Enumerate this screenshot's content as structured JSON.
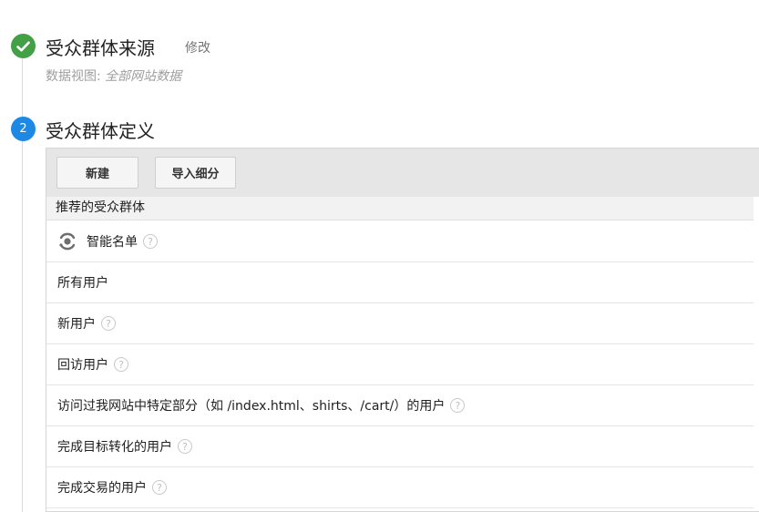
{
  "step1": {
    "title": "受众群体来源",
    "edit_label": "修改",
    "source_prefix": "数据视图:",
    "source_value": "全部网站数据"
  },
  "step2": {
    "number": "2",
    "title": "受众群体定义"
  },
  "toolbar": {
    "new_label": "新建",
    "import_label": "导入细分"
  },
  "section_header": "推荐的受众群体",
  "help_glyph": "?",
  "audiences": [
    {
      "label": "智能名单",
      "icon": "smart-list-icon",
      "help": true
    },
    {
      "label": "所有用户",
      "help": false
    },
    {
      "label": "新用户",
      "help": true
    },
    {
      "label": "回访用户",
      "help": true
    },
    {
      "label": "访问过我网站中特定部分（如 /index.html、shirts、/cart/）的用户",
      "help": true
    },
    {
      "label": "完成目标转化的用户",
      "help": true
    },
    {
      "label": "完成交易的用户",
      "help": true
    }
  ],
  "colors": {
    "step_done": "#43a047",
    "step_active": "#1e88e5",
    "toolbar_bg": "#e6e6e6"
  }
}
